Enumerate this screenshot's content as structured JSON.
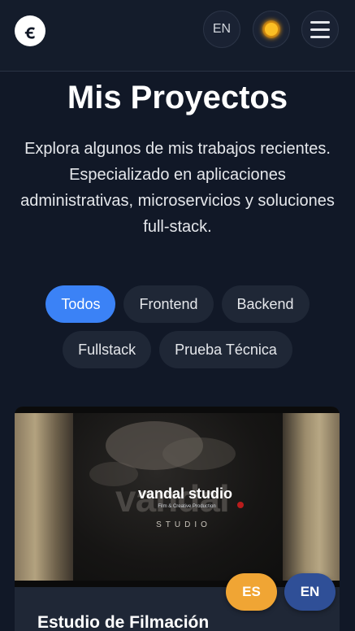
{
  "header": {
    "logo_text": "ꞓ",
    "language_label": "EN",
    "theme_icon": "sun-icon",
    "menu_icon": "hamburger-icon"
  },
  "main": {
    "title": "Mis Proyectos",
    "subtitle": "Explora algunos de mis trabajos recientes. Especializado en aplicaciones administrativas, microservicios y soluciones full-stack.",
    "filters": [
      {
        "label": "Todos",
        "active": true
      },
      {
        "label": "Frontend",
        "active": false
      },
      {
        "label": "Backend",
        "active": false
      },
      {
        "label": "Fullstack",
        "active": false
      },
      {
        "label": "Prueba Técnica",
        "active": false
      }
    ]
  },
  "project_card": {
    "image": {
      "brand_name": "vandal studio",
      "brand_tagline": "Film & Creative Production",
      "brand_sub": "STUDIO",
      "background_word": "vandal"
    },
    "title": "Estudio de Filmación"
  },
  "language_switcher": {
    "es_label": "ES",
    "en_label": "EN"
  },
  "colors": {
    "background": "#111827",
    "accent": "#3b82f6",
    "es_button": "#f0a534",
    "en_button": "#2f4f97"
  }
}
